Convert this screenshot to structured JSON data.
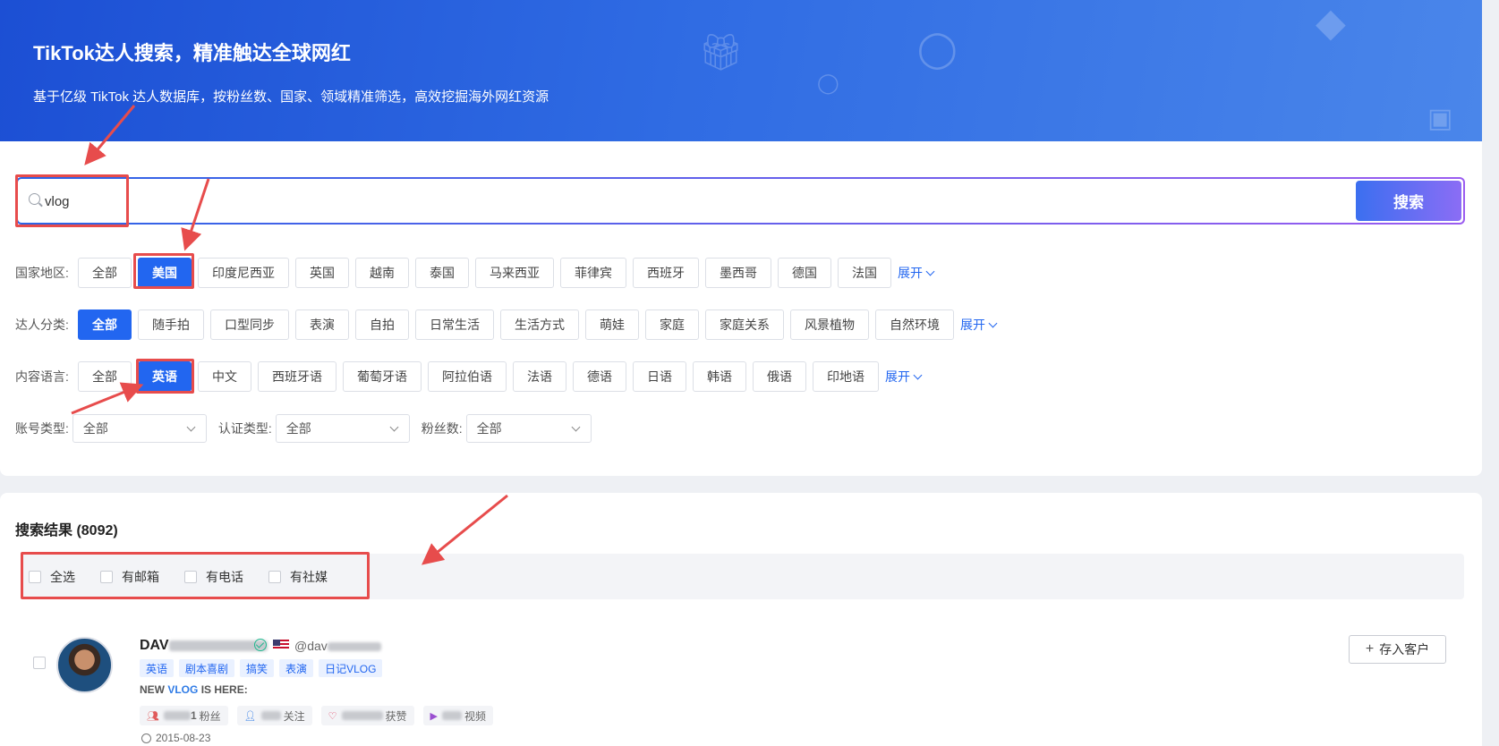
{
  "banner": {
    "title": "TikTok达人搜索，精准触达全球网红",
    "subtitle": "基于亿级 TikTok 达人数据库，按粉丝数、国家、领域精准筛选，高效挖掘海外网红资源"
  },
  "search": {
    "value": "vlog",
    "button_label": "搜索"
  },
  "expand_label": "展开",
  "filters": {
    "country": {
      "label": "国家地区:",
      "options": [
        "全部",
        "美国",
        "印度尼西亚",
        "英国",
        "越南",
        "泰国",
        "马来西亚",
        "菲律宾",
        "西班牙",
        "墨西哥",
        "德国",
        "法国"
      ],
      "selected": "美国"
    },
    "category": {
      "label": "达人分类:",
      "options": [
        "全部",
        "随手拍",
        "口型同步",
        "表演",
        "自拍",
        "日常生活",
        "生活方式",
        "萌娃",
        "家庭",
        "家庭关系",
        "风景植物",
        "自然环境"
      ],
      "selected": "全部"
    },
    "language": {
      "label": "内容语言:",
      "options": [
        "全部",
        "英语",
        "中文",
        "西班牙语",
        "葡萄牙语",
        "阿拉伯语",
        "法语",
        "德语",
        "日语",
        "韩语",
        "俄语",
        "印地语"
      ],
      "selected": "英语"
    }
  },
  "selects": {
    "account_type": {
      "label": "账号类型:",
      "value": "全部"
    },
    "verify_type": {
      "label": "认证类型:",
      "value": "全部"
    },
    "followers": {
      "label": "粉丝数:",
      "value": "全部"
    }
  },
  "results": {
    "title": "搜索结果 (8092)",
    "checks": [
      "全选",
      "有邮箱",
      "有电话",
      "有社媒"
    ]
  },
  "creator": {
    "name_prefix": "DAV",
    "handle_prefix": "@dav",
    "tags": [
      "英语",
      "剧本喜剧",
      "搞笑",
      "表演",
      "日记VLOG"
    ],
    "bio_prefix": "NEW ",
    "bio_highlight": "VLOG",
    "bio_suffix": " IS HERE:",
    "stats": {
      "followers_label": "粉丝",
      "following_label": "关注",
      "likes_label": "获赞",
      "videos_label": "视频"
    },
    "followers_digit": "1",
    "date": "2015-08-23",
    "save_label": "存入客户"
  },
  "colors": {
    "primary": "#2266f0",
    "annotation": "#e74c4c"
  }
}
